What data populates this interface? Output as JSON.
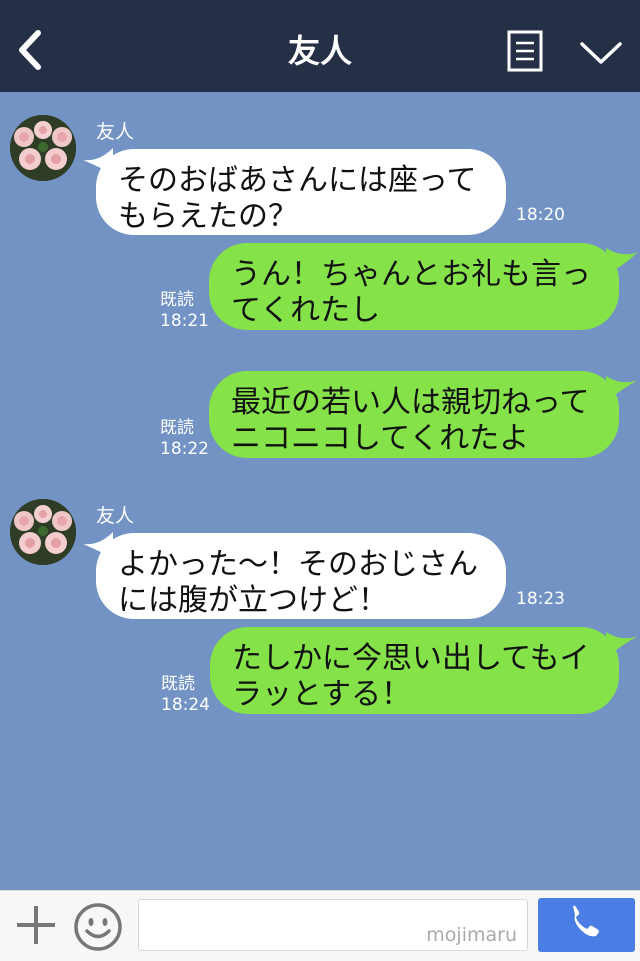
{
  "header": {
    "title": "友人",
    "back_icon": "chevron-left-icon",
    "menu_icon": "menu-list-icon",
    "more_icon": "chevron-down-icon"
  },
  "messages": [
    {
      "side": "left",
      "sender": "友人",
      "lines": [
        "そのおばあさんには座って",
        "もらえたの？"
      ],
      "time": "18:20"
    },
    {
      "side": "right",
      "read": "既読",
      "lines": [
        "うん！ちゃんとお礼も言っ",
        "てくれたし"
      ],
      "time": "18:21"
    },
    {
      "side": "right",
      "read": "既読",
      "lines": [
        "最近の若い人は親切ねって",
        "ニコニコしてくれたよ"
      ],
      "time": "18:22"
    },
    {
      "side": "left",
      "sender": "友人",
      "lines": [
        "よかった〜！そのおじさん",
        "には腹が立つけど！"
      ],
      "time": "18:23"
    },
    {
      "side": "right",
      "read": "既読",
      "lines": [
        "たしかに今思い出してもイ",
        "ラッとする！"
      ],
      "time": "18:24"
    }
  ],
  "input_bar": {
    "plus_icon": "plus-icon",
    "emoji_icon": "smiley-icon",
    "placeholder": "",
    "watermark": "mojimaru",
    "call_icon": "phone-icon"
  },
  "colors": {
    "header_bg": "#253047",
    "chat_bg": "#7293c4",
    "friend_bubble": "#ffffff",
    "my_bubble": "#85e249",
    "call_button": "#4a7ee4"
  }
}
